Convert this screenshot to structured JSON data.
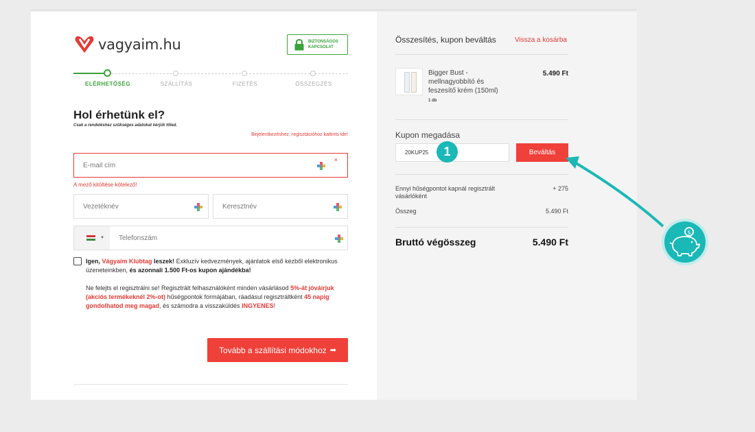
{
  "brand": {
    "logo_text": "vagyaim.hu",
    "secure_badge_line1": "BIZTONSÁGOS",
    "secure_badge_line2": "KAPCSOLAT",
    "accent_color": "#e53935",
    "step_color": "#3aa23a",
    "highlight_color": "#1ab8b6"
  },
  "steps": [
    {
      "label": "ELÉRHETŐSÉG",
      "active": true
    },
    {
      "label": "SZÁLLÍTÁS",
      "active": false
    },
    {
      "label": "FIZETÉS",
      "active": false
    },
    {
      "label": "ÖSSZEGZÉS",
      "active": false
    }
  ],
  "contact": {
    "heading": "Hol érhetünk el?",
    "subheading": "Csak a rendeléshez szükséges adatokat kérjük tőled.",
    "login_link": "Bejelentkezéshez, regisztációhoz kattints ide!",
    "email_placeholder": "E-mail cím",
    "email_error_x": "×",
    "email_error": "A mező kitöltése kötelező!",
    "lastname_placeholder": "Vezetéknév",
    "firstname_placeholder": "Keresztnév",
    "phone_placeholder": "Telefonszám",
    "club_prefix": "Igen, ",
    "club_name": "Vágyaim Klubtag",
    "club_bold": " leszek!",
    "club_body": " Exkluzív kedvezmények, ajánlatok első kézből elektronikus üzeneteinkben, ",
    "club_gift": "és azonnali 1.500 Ft-os kupon ajándékba!",
    "reg_1": "Ne felejts el regisztrálni se! Regisztrált felhasználóként minden vásárlásod ",
    "reg_red1": "5%-át jóváírjuk (akciós termékeknél 2%-ot)",
    "reg_2": " hűségpontok formájában, ráadásul regisztráltként ",
    "reg_red2": "45 napig gondolhatod meg magad",
    "reg_3": ", és számodra a visszaküldés ",
    "reg_red3": "INGYENES",
    "reg_4": "!",
    "next_button": "Tovább a szállítási módokhoz",
    "next_arrow": "➡"
  },
  "summary": {
    "title": "Összesítés, kupon beváltás",
    "back_link": "Vissza a kosárba",
    "product_name": "Bigger Bust - mellnagyobbító és feszesítő krém (150ml)",
    "product_qty": "1 db",
    "product_price": "5.490 Ft",
    "coupon_title": "Kupon megadása",
    "coupon_value": "20KUP25",
    "coupon_badge": "1",
    "redeem_button": "Beváltás",
    "loyalty_label": "Ennyi hűségpontot kapnál regisztrált vásárlóként",
    "loyalty_value": "+ 275",
    "sum_label": "Összeg",
    "sum_value": "5.490 Ft",
    "gross_label": "Bruttó végösszeg",
    "gross_value": "5.490 Ft"
  }
}
